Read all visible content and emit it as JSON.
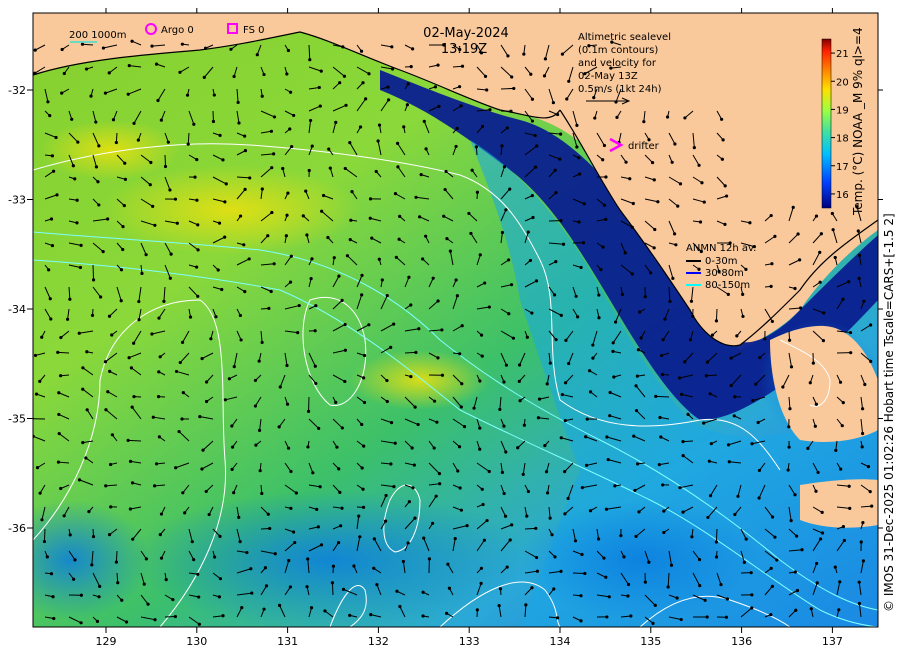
{
  "header": {
    "date": "02-May-2024",
    "time": "13:19Z"
  },
  "legend_top": {
    "depth_label": "200  1000m",
    "argo_label": "Argo 0",
    "fs_label": "FS 0"
  },
  "sealevel_note": {
    "lines": [
      "Altimetric sealevel",
      "(0.1m contours)",
      "and velocity for",
      "02-May 13Z",
      "0.5m/s (1kt 24h)"
    ]
  },
  "drifter_label": "drifter",
  "anmn": {
    "title": "ANMN 12h av.",
    "items": [
      {
        "label": "0-30m",
        "color": "#000000"
      },
      {
        "label": "30-80m",
        "color": "#0000ff"
      },
      {
        "label": "80-150m",
        "color": "#00ffff"
      }
    ]
  },
  "colorbar": {
    "label": "Temp. (°C) NOAA _M 9% ql>=4",
    "ticks": [
      "16",
      "17",
      "18",
      "19",
      "20",
      "21"
    ],
    "min": 15.5,
    "max": 21.5
  },
  "credit": "© IMOS 31-Dec-2025 01:02:26 Hobart time Tscale=CARS+[-1.5 2]",
  "axes": {
    "lon_ticks": [
      "129",
      "130",
      "131",
      "132",
      "133",
      "134",
      "135",
      "136",
      "137"
    ],
    "lat_ticks": [
      "-32",
      "-33",
      "-34",
      "-35",
      "-36"
    ]
  },
  "colors": {
    "land": "#f9c89b",
    "ocean_warm": "#7fd13b",
    "ocean_mid": "#35c46e",
    "ocean_cool": "#1e90ff",
    "ocean_cold": "#0a1f8f",
    "argo": "#ff00ff"
  }
}
